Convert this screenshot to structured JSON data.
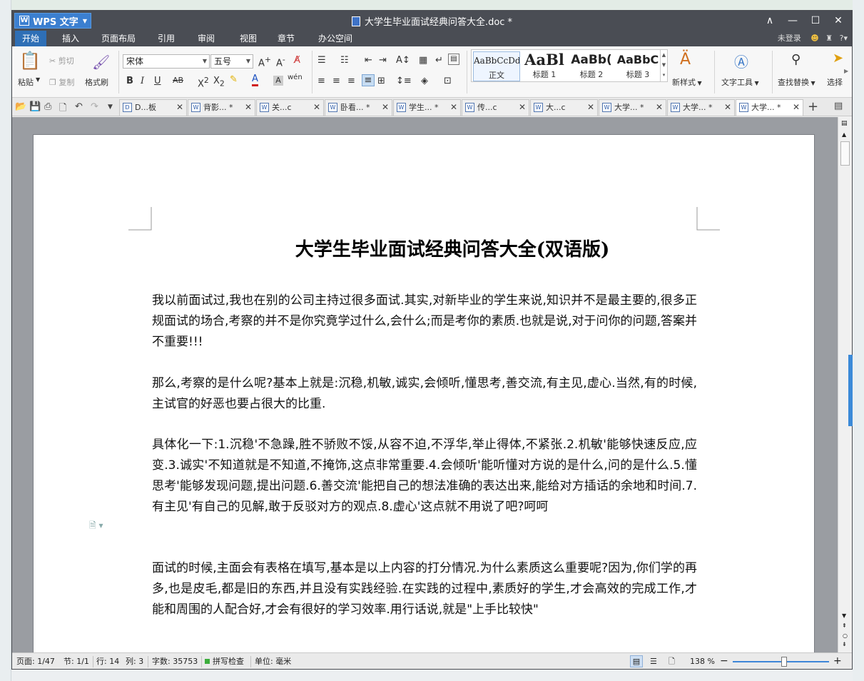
{
  "app": {
    "name": "WPS 文字",
    "doc_title": "大学生毕业面试经典问答大全.doc *"
  },
  "window_controls": {
    "up": "∧",
    "minimize": "—",
    "maximize": "☐",
    "close": "✕"
  },
  "menu": {
    "items": [
      "开始",
      "插入",
      "页面布局",
      "引用",
      "审阅",
      "视图",
      "章节",
      "办公空间"
    ],
    "login": "未登录",
    "help": "?"
  },
  "ribbon": {
    "paste": "粘贴",
    "cut": "剪切",
    "copy": "复制",
    "format_painter": "格式刷",
    "font": "宋体",
    "size": "五号",
    "styles": [
      {
        "preview": "AaBbCcDd",
        "label": "正文"
      },
      {
        "preview": "AaBl",
        "label": "标题 1"
      },
      {
        "preview": "AaBb(",
        "label": "标题 2"
      },
      {
        "preview": "AaBbC",
        "label": "标题 3"
      }
    ],
    "new_style": "新样式",
    "text_tools": "文字工具",
    "find_replace": "查找替换",
    "select": "选择"
  },
  "tabs": [
    {
      "label": "D...板",
      "icon": "D"
    },
    {
      "label": "背影... *",
      "icon": "W"
    },
    {
      "label": "关...c",
      "icon": "W"
    },
    {
      "label": "卧看... *",
      "icon": "W"
    },
    {
      "label": "学生... *",
      "icon": "W"
    },
    {
      "label": "传...c",
      "icon": "W"
    },
    {
      "label": "大...c",
      "icon": "W"
    },
    {
      "label": "大学... *",
      "icon": "W"
    },
    {
      "label": "大学... *",
      "icon": "W"
    },
    {
      "label": "大学... *",
      "icon": "W"
    }
  ],
  "document": {
    "heading": "大学生毕业面试经典问答大全(双语版)",
    "paragraphs": [
      "我以前面试过,我也在别的公司主持过很多面试.其实,对新毕业的学生来说,知识并不是最主要的,很多正规面试的场合,考察的并不是你究竟学过什么,会什么;而是考你的素质.也就是说,对于问你的问题,答案并不重要!!!",
      "那么,考察的是什么呢?基本上就是:沉稳,机敏,诚实,会倾听,懂思考,善交流,有主见,虚心.当然,有的时候,主试官的好恶也要占很大的比重.",
      "具体化一下:1.沉稳'不急躁,胜不骄败不馁,从容不迫,不浮华,举止得体,不紧张.2.机敏'能够快速反应,应变.3.诚实'不知道就是不知道,不掩饰,这点非常重要.4.会倾听'能听懂对方说的是什么,问的是什么.5.懂思考'能够发现问题,提出问题.6.善交流'能把自己的想法准确的表达出来,能给对方插话的余地和时间.7.有主见'有自己的见解,敢于反驳对方的观点.8.虚心'这点就不用说了吧?呵呵",
      "面试的时候,主面会有表格在填写,基本是以上内容的打分情况.为什么素质这么重要呢?因为,你们学的再多,也是皮毛,都是旧的东西,并且没有实践经验.在实践的过程中,素质好的学生,才会高效的完成工作,才能和周围的人配合好,才会有很好的学习效率.用行话说,就是\"上手比较快\""
    ]
  },
  "status": {
    "page": "页面: 1/47",
    "section": "节: 1/1",
    "row": "行: 14",
    "col": "列: 3",
    "words": "字数: 35753",
    "spell": "拼写检查",
    "unit": "单位: 毫米",
    "zoom": "138 %",
    "zoom_level": 0.55
  },
  "colors": {
    "accent": "#2e6fb6",
    "titlebar": "#4a4d54"
  }
}
